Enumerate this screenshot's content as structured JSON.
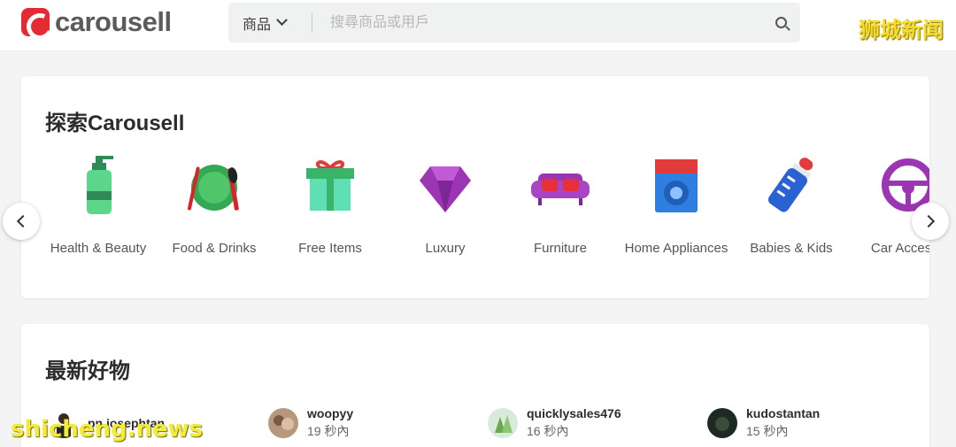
{
  "header": {
    "logo_text": "carousell",
    "search": {
      "category_label": "商品",
      "placeholder": "搜尋商品或用戶"
    },
    "watermark": "狮城新闻"
  },
  "explore": {
    "title": "探索Carousell",
    "cutoff_left": "'",
    "categories": [
      {
        "label": "Health & Beauty",
        "icon": "soap-bottle-icon"
      },
      {
        "label": "Food & Drinks",
        "icon": "plate-cutlery-icon"
      },
      {
        "label": "Free Items",
        "icon": "gift-box-icon"
      },
      {
        "label": "Luxury",
        "icon": "diamond-icon"
      },
      {
        "label": "Furniture",
        "icon": "sofa-icon"
      },
      {
        "label": "Home Appliances",
        "icon": "washing-machine-icon"
      },
      {
        "label": "Babies & Kids",
        "icon": "baby-bottle-icon"
      },
      {
        "label": "Car Accesso",
        "icon": "steering-wheel-icon"
      }
    ]
  },
  "latest": {
    "title": "最新好物",
    "listings": [
      {
        "seller": "pn.josephtan",
        "time": ""
      },
      {
        "seller": "woopyy",
        "time": "19 秒內"
      },
      {
        "seller": "quicklysales476",
        "time": "16 秒內"
      },
      {
        "seller": "kudostantan",
        "time": "15 秒內"
      }
    ]
  },
  "watermark_bottom": "shicheng.news"
}
